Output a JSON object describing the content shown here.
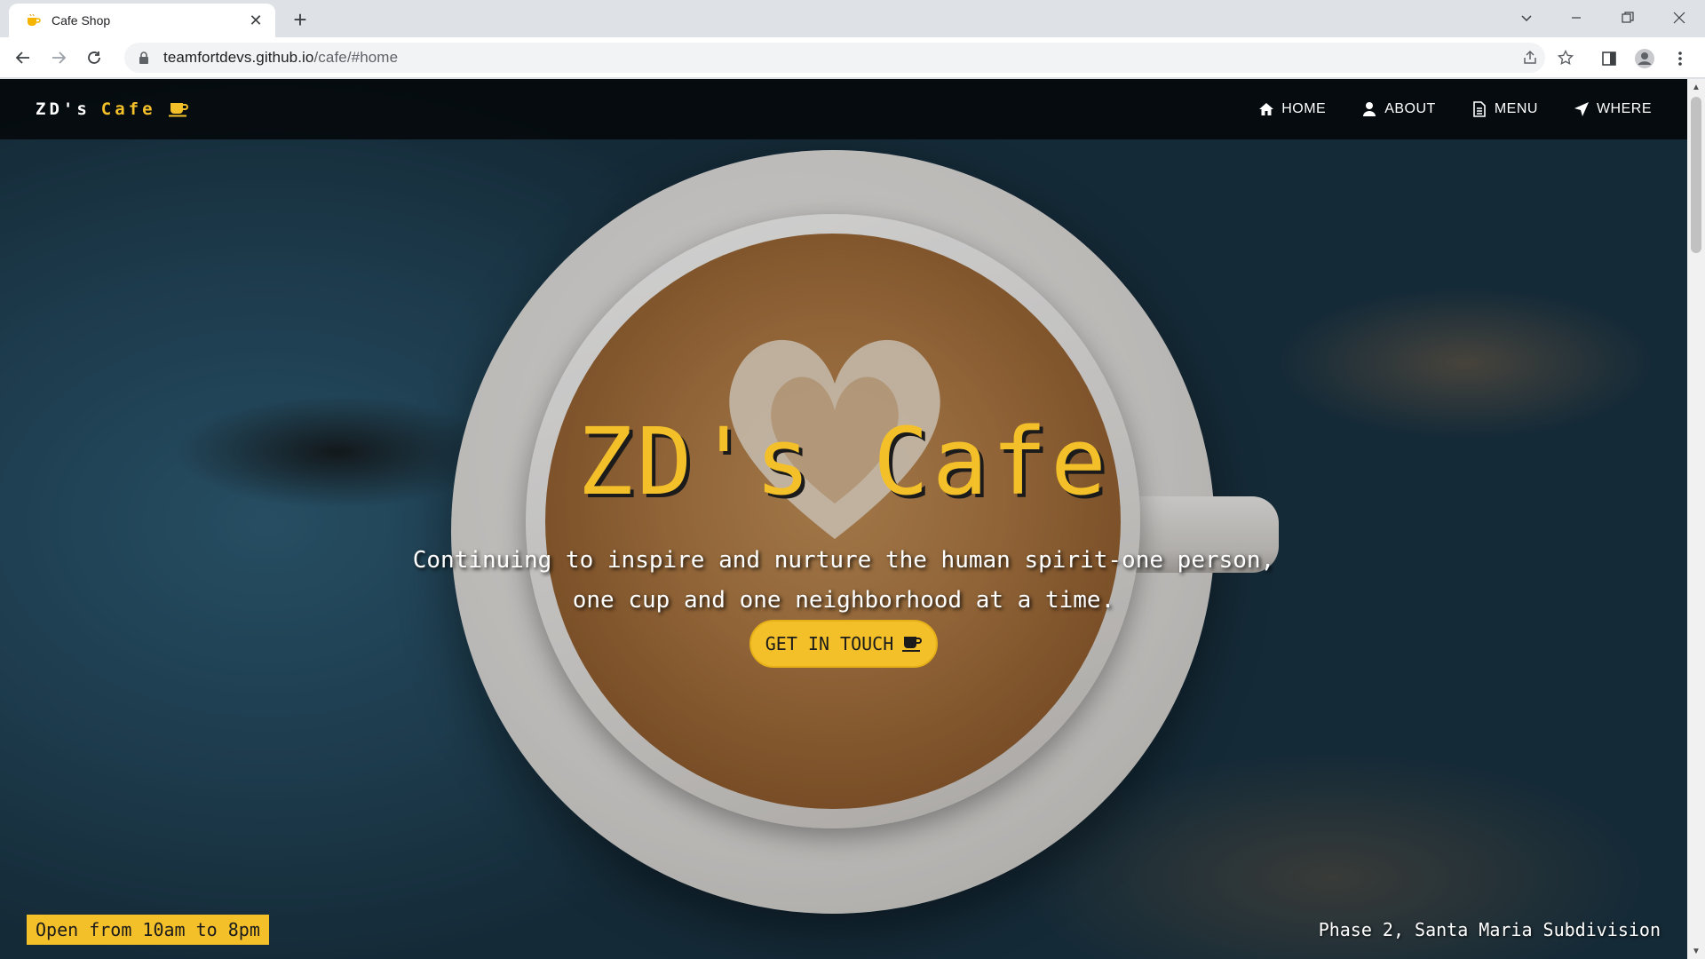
{
  "browser": {
    "tab_title": "Cafe Shop",
    "url_host": "teamfortdevs.github.io",
    "url_path": "/cafe/#home"
  },
  "site": {
    "brand_left": "ZD's",
    "brand_right": "Cafe",
    "nav": [
      {
        "label": "HOME",
        "icon": "home-icon"
      },
      {
        "label": "ABOUT",
        "icon": "user-icon"
      },
      {
        "label": "MENU",
        "icon": "document-icon"
      },
      {
        "label": "WHERE",
        "icon": "location-arrow-icon"
      }
    ]
  },
  "hero": {
    "title": "ZD's Cafe",
    "subtitle_line1": "Continuing to inspire and nurture the human spirit-one person,",
    "subtitle_line2": "one cup and one neighborhood at a time.",
    "cta_label": "GET IN TOUCH",
    "hours": "Open from 10am to 8pm",
    "address": "Phase 2, Santa Maria Subdivision"
  },
  "colors": {
    "accent": "#f4c02a",
    "nav_bg": "#000000",
    "text_light": "#ffffff"
  }
}
